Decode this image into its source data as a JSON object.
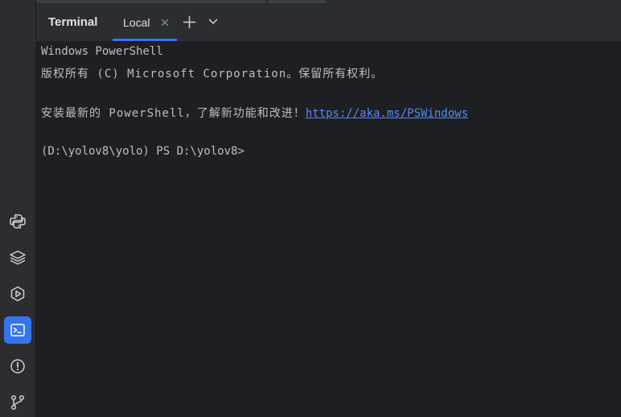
{
  "tool_window": {
    "title": "Terminal",
    "tabs": [
      {
        "label": "Local",
        "active": true
      }
    ],
    "new_tab_icon": "plus-icon",
    "dropdown_icon": "chevron-down-icon"
  },
  "sidebar": {
    "items": [
      {
        "icon": "python-icon",
        "active": false
      },
      {
        "icon": "layers-icon",
        "active": false
      },
      {
        "icon": "services-icon",
        "active": false
      },
      {
        "icon": "terminal-icon",
        "active": true
      },
      {
        "icon": "problems-icon",
        "active": false
      },
      {
        "icon": "git-icon",
        "active": false
      }
    ]
  },
  "terminal": {
    "line1": "Windows PowerShell",
    "line2": "版权所有 (C) Microsoft Corporation。保留所有权利。",
    "line3_text": "安装最新的 PowerShell，了解新功能和改进！",
    "line3_link": "https://aka.ms/PSWindows",
    "prompt": "(D:\\yolov8\\yolo) PS D:\\yolov8>"
  },
  "colors": {
    "accent": "#3574f0",
    "link": "#548af7",
    "text": "#bcbec4",
    "background": "#1e1f22",
    "panel": "#2b2d30"
  }
}
